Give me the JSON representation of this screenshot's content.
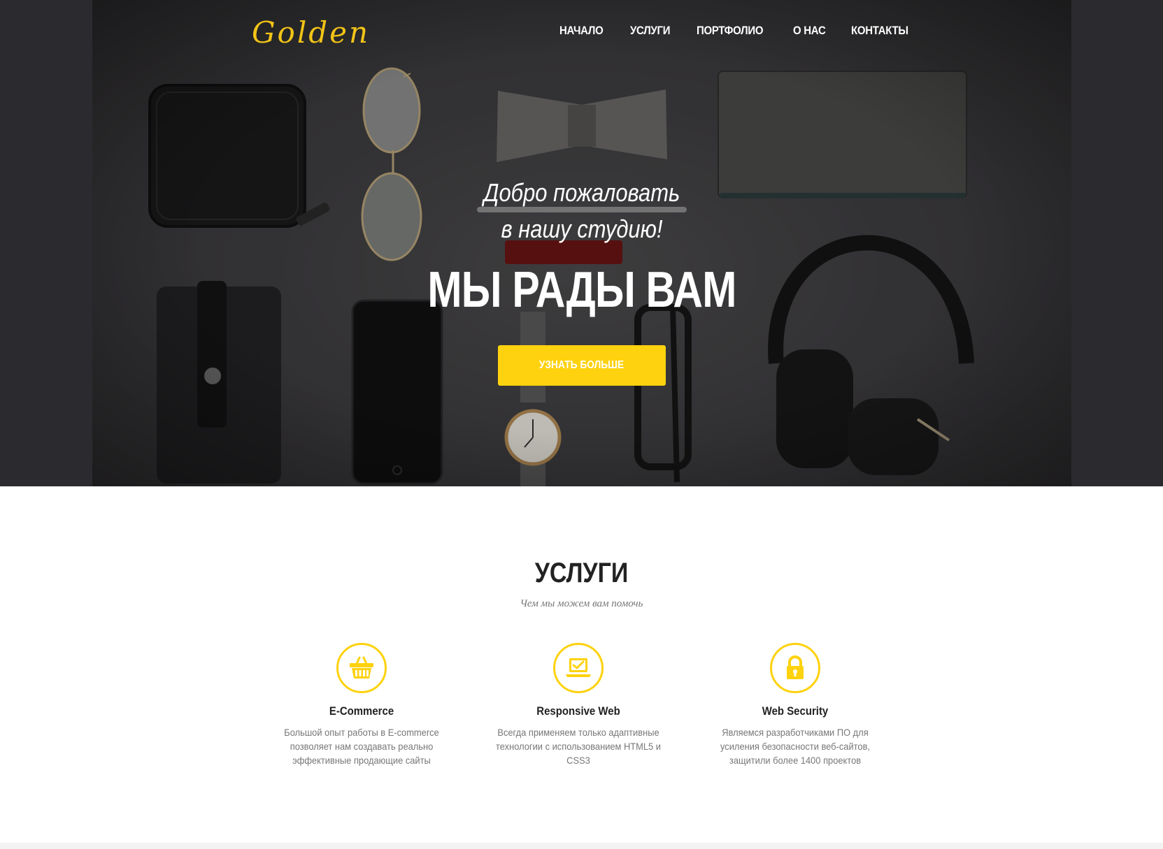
{
  "brand": {
    "logo_text": "Golden",
    "accent_color": "#fed20e"
  },
  "nav": {
    "items": [
      {
        "label": "НАЧАЛО"
      },
      {
        "label": "УСЛУГИ"
      },
      {
        "label": "ПОРТФОЛИО"
      },
      {
        "label": "О НАС"
      },
      {
        "label": "КОНТАКТЫ"
      }
    ]
  },
  "hero": {
    "welcome_line1": "Добро пожаловать",
    "welcome_line2": "в нашу студию!",
    "headline": "МЫ РАДЫ ВАМ",
    "cta_label": "УЗНАТЬ БОЛЬШЕ"
  },
  "services": {
    "title": "УСЛУГИ",
    "subtitle": "Чем мы можем вам помочь",
    "items": [
      {
        "icon": "shopping-basket-icon",
        "title": "E-Commerce",
        "text": "Большой опыт работы в E-commerce позволяет нам создавать реально эффективные продающие сайты"
      },
      {
        "icon": "laptop-check-icon",
        "title": "Responsive Web",
        "text": "Всегда применяем только адаптивные технологии с использованием HTML5 и CSS3"
      },
      {
        "icon": "lock-icon",
        "title": "Web Security",
        "text": "Являемся разработчиками ПО для усиления безопасности веб-сайтов, защитили более 1400 проектов"
      }
    ]
  }
}
